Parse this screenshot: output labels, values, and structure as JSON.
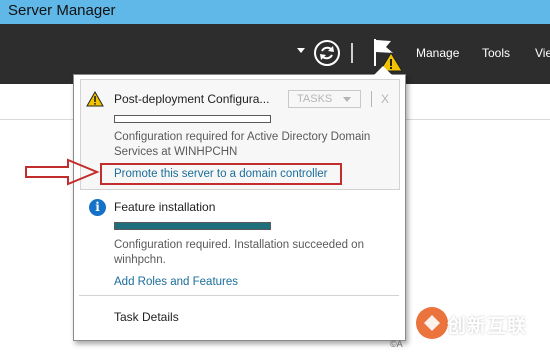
{
  "window": {
    "title": "Server Manager"
  },
  "toolbar": {
    "menu": [
      "Manage",
      "Tools",
      "Vie"
    ],
    "icons": [
      "dropdown-caret-icon",
      "refresh-icon",
      "flag-warning-icon"
    ]
  },
  "notifications": {
    "post_deployment": {
      "title": "Post-deployment Configura...",
      "tasks_label": "TASKS",
      "close_label": "X",
      "progress": 0,
      "description": "Configuration required for Active Directory Domain Services at WINHPCHN",
      "link": "Promote this server to a domain controller"
    },
    "feature_installation": {
      "title": "Feature installation",
      "progress": 1.0,
      "description": "Configuration required. Installation succeeded on winhpchn.",
      "link": "Add Roles and Features"
    },
    "task_details": "Task Details"
  },
  "watermark": {
    "text": "创新互联",
    "suffix": "©A"
  },
  "colors": {
    "titlebar": "#5fb8e7",
    "toolbar": "#2d2d2d",
    "link": "#1b6d9a",
    "progress_fill": "#1e6f7c",
    "highlight": "#c22d2d"
  }
}
